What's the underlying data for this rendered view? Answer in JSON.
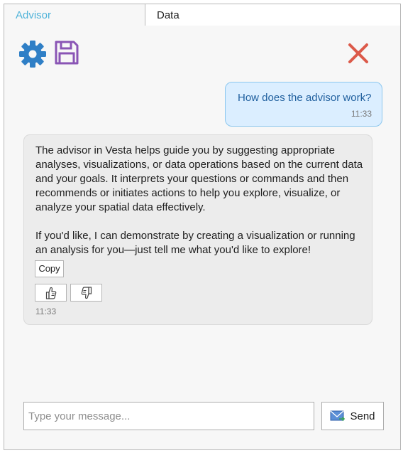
{
  "tabs": [
    {
      "label": "Advisor",
      "active": true
    },
    {
      "label": "Data",
      "active": false
    }
  ],
  "toolbar": {
    "settings_icon": "gear-icon",
    "save_icon": "floppy-disk-icon",
    "close_icon": "close-icon"
  },
  "colors": {
    "accent": "#4fb3d9",
    "gear": "#2f7fc6",
    "save": "#8a55b5",
    "close": "#dc5a4a",
    "user_bubble_bg": "#dbeeff",
    "user_text": "#1f5f9e"
  },
  "conversation": {
    "user_message": {
      "text": "How does the advisor work?",
      "time": "11:33"
    },
    "bot_message": {
      "paragraphs": [
        "The advisor in Vesta helps guide you by suggesting appropriate analyses, visualizations, or data operations based on the current data and your goals. It interprets your questions or commands and then recommends or initiates actions to help you explore, visualize, or analyze your spatial data effectively.",
        "If you'd like, I can demonstrate by creating a visualization or running an analysis for you—just tell me what you'd like to explore!"
      ],
      "copy_label": "Copy",
      "thumbs_up_icon": "thumbs-up-icon",
      "thumbs_down_icon": "thumbs-down-icon",
      "time": "11:33"
    }
  },
  "composer": {
    "placeholder": "Type your message...",
    "value": "",
    "send_label": "Send",
    "send_icon": "envelope-send-icon"
  }
}
